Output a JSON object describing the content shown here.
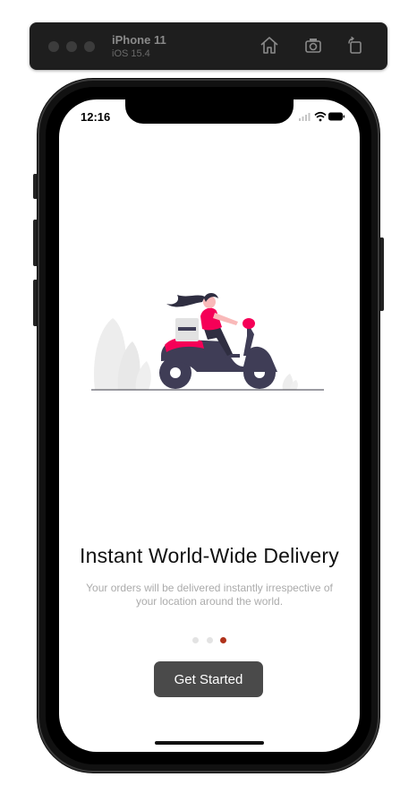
{
  "simulator": {
    "device_name": "iPhone 11",
    "os_version": "iOS 15.4",
    "toolbar_icons": [
      "home-icon",
      "screenshot-icon",
      "rotate-icon"
    ]
  },
  "status_bar": {
    "time": "12:16",
    "icons": [
      "signal-icon",
      "wifi-icon",
      "battery-icon"
    ]
  },
  "onboarding": {
    "title": "Instant World-Wide Delivery",
    "subtitle": "Your orders will be delivered instantly irrespective of your location around the world.",
    "illustration": "delivery-scooter-illustration",
    "pages_total": 3,
    "active_page": 3,
    "cta_label": "Get Started"
  },
  "colors": {
    "accent": "#f50057",
    "dot_active": "#b0321b",
    "button_bg": "#4a4a4a",
    "subtitle_text": "#ababab"
  }
}
